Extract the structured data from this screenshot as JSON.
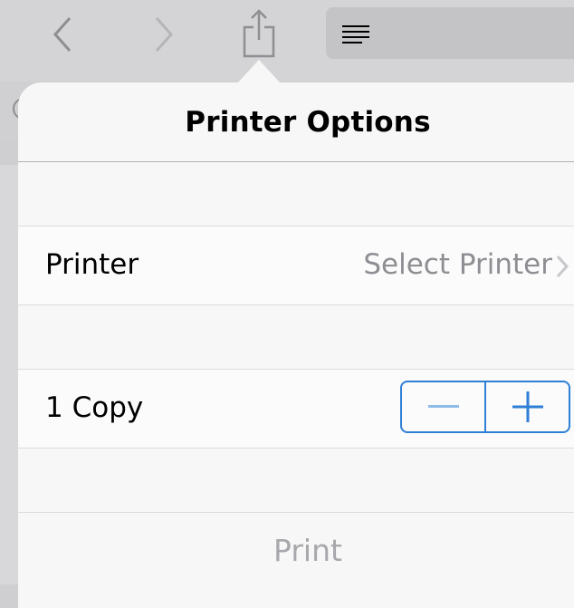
{
  "toolbar": {
    "icons": [
      "back-chevron-icon",
      "forward-chevron-icon",
      "share-icon",
      "reader-icon"
    ]
  },
  "popover": {
    "title": "Printer Options",
    "printer_row": {
      "label": "Printer",
      "value": "Select Printer",
      "icon": "chevron-right-icon"
    },
    "copies_row": {
      "label": "1 Copy",
      "minus_icon": "minus-icon",
      "plus_icon": "plus-icon"
    },
    "print_button": "Print"
  },
  "colors": {
    "accent": "#2f7fd6",
    "disabled_minus": "#8fbde9",
    "secondary_text": "#8e8e93",
    "print_disabled": "#a8a8ac"
  }
}
